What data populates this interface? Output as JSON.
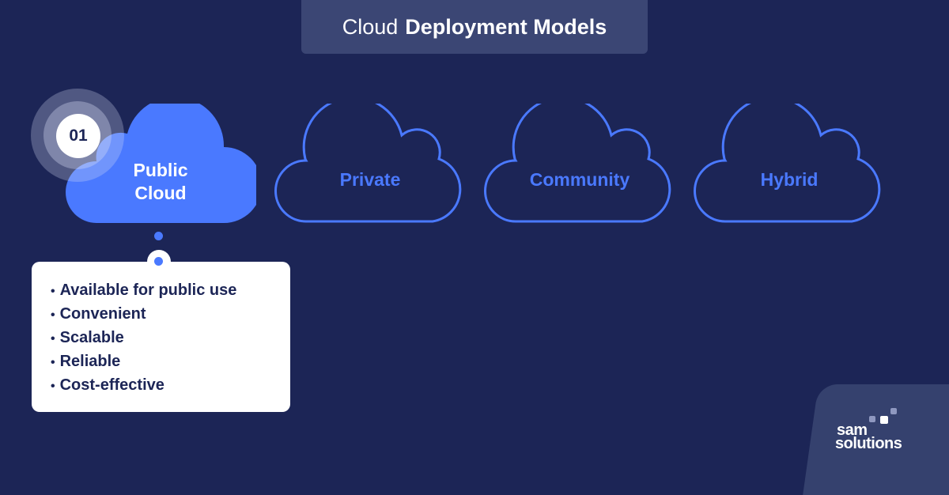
{
  "title": {
    "light": "Cloud",
    "bold": "Deployment Models"
  },
  "badge": {
    "number": "01"
  },
  "clouds": [
    {
      "line1": "Public",
      "line2": "Cloud",
      "active": true
    },
    {
      "label": "Private"
    },
    {
      "label": "Community"
    },
    {
      "label": "Hybrid"
    }
  ],
  "details": {
    "items": [
      "Available for public use",
      "Convenient",
      "Scalable",
      "Reliable",
      "Cost-effective"
    ]
  },
  "logo": {
    "line1": "sam",
    "line2": "solutions"
  },
  "colors": {
    "background": "#1c2556",
    "accent": "#4a79ff",
    "title_bg": "#3b4674",
    "card": "#ffffff"
  }
}
